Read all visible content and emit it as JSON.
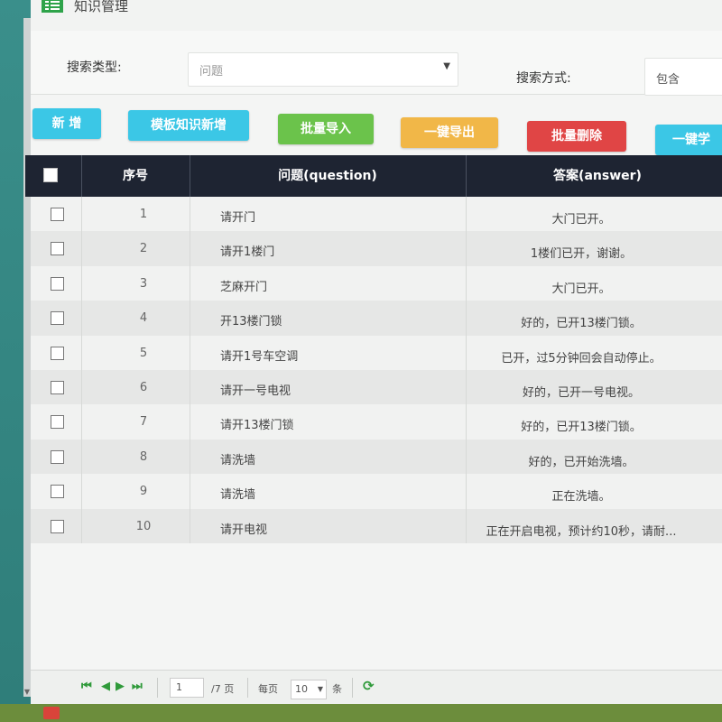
{
  "window": {
    "title": "知识管理"
  },
  "filters": {
    "search_type_label": "搜索类型:",
    "search_type_value": "问题",
    "search_method_label": "搜索方式:",
    "search_method_value": "包含"
  },
  "toolbar": {
    "add": "新 增",
    "template_add": "模板知识新增",
    "batch_import": "批量导入",
    "export_all": "一键导出",
    "batch_delete": "批量删除",
    "one_click_learn": "一键学"
  },
  "table": {
    "columns": [
      "序号",
      "问题(question)",
      "答案(answer)"
    ],
    "rows": [
      {
        "no": "1",
        "question": "请开门",
        "answer": "大门已开。"
      },
      {
        "no": "2",
        "question": "请开1楼门",
        "answer": "1楼们已开，谢谢。"
      },
      {
        "no": "3",
        "question": "芝麻开门",
        "answer": "大门已开。"
      },
      {
        "no": "4",
        "question": "开13楼门锁",
        "answer": "好的，已开13楼门锁。"
      },
      {
        "no": "5",
        "question": "请开1号车空调",
        "answer": "已开，过5分钟回会自动停止。"
      },
      {
        "no": "6",
        "question": "请开一号电视",
        "answer": "好的，已开一号电视。"
      },
      {
        "no": "7",
        "question": "请开13楼门锁",
        "answer": "好的，已开13楼门锁。"
      },
      {
        "no": "8",
        "question": "请洗墙",
        "answer": "好的，已开始洗墙。"
      },
      {
        "no": "9",
        "question": "请洗墙",
        "answer": "正在洗墙。"
      },
      {
        "no": "10",
        "question": "请开电视",
        "answer": "正在开启电视，预计约10秒，请耐..."
      }
    ]
  },
  "pager": {
    "page": "1",
    "total_pages": "/7 页",
    "per_page_label": "每页",
    "per_page_value": "10",
    "per_page_unit": "条"
  }
}
